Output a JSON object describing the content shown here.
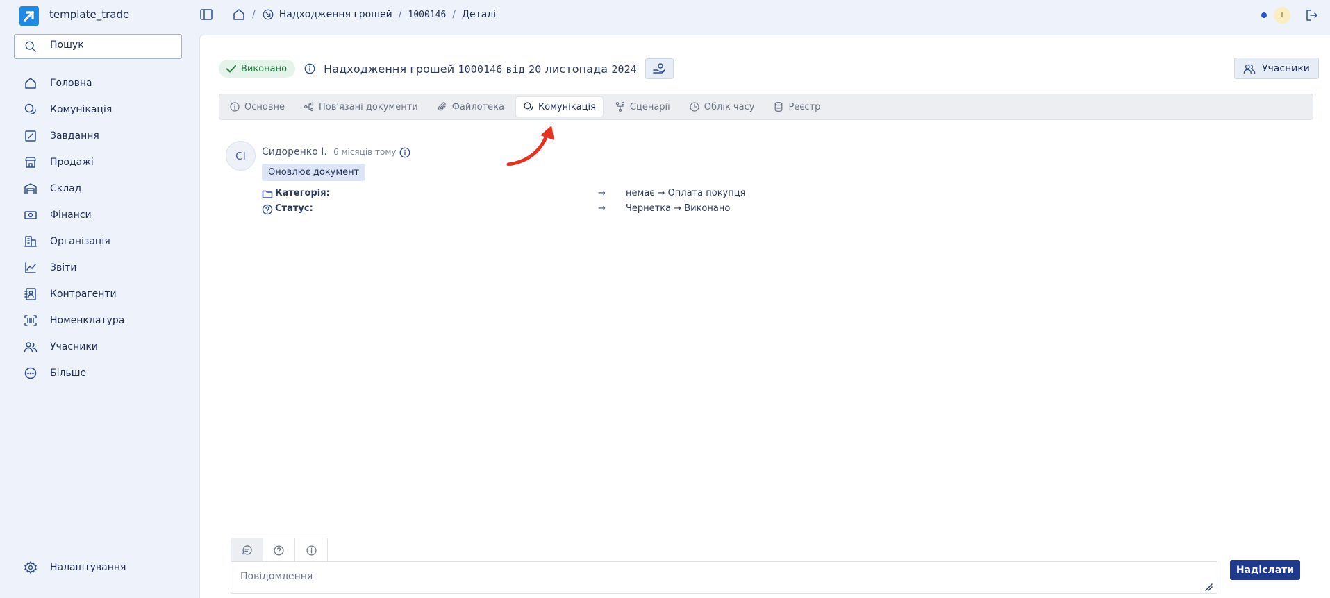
{
  "app": {
    "name": "template_trade"
  },
  "search": {
    "placeholder": "Пошук"
  },
  "sidebar": {
    "items": [
      {
        "label": "Головна",
        "icon": "home-icon"
      },
      {
        "label": "Комунікація",
        "icon": "chat-icon"
      },
      {
        "label": "Завдання",
        "icon": "tasks-icon"
      },
      {
        "label": "Продажі",
        "icon": "store-icon"
      },
      {
        "label": "Склад",
        "icon": "warehouse-icon"
      },
      {
        "label": "Фінанси",
        "icon": "money-icon"
      },
      {
        "label": "Організація",
        "icon": "building-icon"
      },
      {
        "label": "Звіти",
        "icon": "chart-icon"
      },
      {
        "label": "Контрагенти",
        "icon": "contact-icon"
      },
      {
        "label": "Номенклатура",
        "icon": "barcode-icon"
      },
      {
        "label": "Учасники",
        "icon": "users-icon"
      },
      {
        "label": "Більше",
        "icon": "more-icon"
      }
    ],
    "settings": {
      "label": "Налаштування",
      "icon": "gear-icon"
    }
  },
  "breadcrumb": {
    "section": "Надходження грошей",
    "number": "1000146",
    "page": "Деталі"
  },
  "user": {
    "initial": "I",
    "status_color": "#2454c7"
  },
  "document": {
    "status": "Виконано",
    "title_prefix": "Надходження грошей",
    "number": "1000146",
    "date_word": "від",
    "date_day": "20",
    "date_rest": "листопада",
    "date_year": "2024",
    "participants_label": "Учасники"
  },
  "tabs": [
    {
      "label": "Основне",
      "icon": "info-icon"
    },
    {
      "label": "Пов'язані документи",
      "icon": "link-nodes-icon"
    },
    {
      "label": "Файлотека",
      "icon": "paperclip-icon"
    },
    {
      "label": "Комунікація",
      "icon": "chat-icon",
      "active": true
    },
    {
      "label": "Сценарії",
      "icon": "flow-icon"
    },
    {
      "label": "Облік часу",
      "icon": "clock-icon"
    },
    {
      "label": "Реєстр",
      "icon": "database-icon"
    }
  ],
  "entry": {
    "avatar": "СІ",
    "author": "Сидоренко І.",
    "time": "6 місяців тому",
    "action": "Оновлює документ",
    "changes": [
      {
        "field": "Категорія:",
        "arrow": "→",
        "value": "немає → Оплата покупця",
        "icon": "folder-icon"
      },
      {
        "field": "Статус:",
        "arrow": "→",
        "value": "Чернетка → Виконано",
        "icon": "question-circle-icon"
      }
    ]
  },
  "composer": {
    "placeholder": "Повідомлення",
    "send_label": "Надіслати"
  },
  "colors": {
    "accent": "#1e3a8f",
    "status_done_bg": "#e5f4ea",
    "status_done_text": "#1f7a3e",
    "annotation_arrow": "#e8321e"
  }
}
